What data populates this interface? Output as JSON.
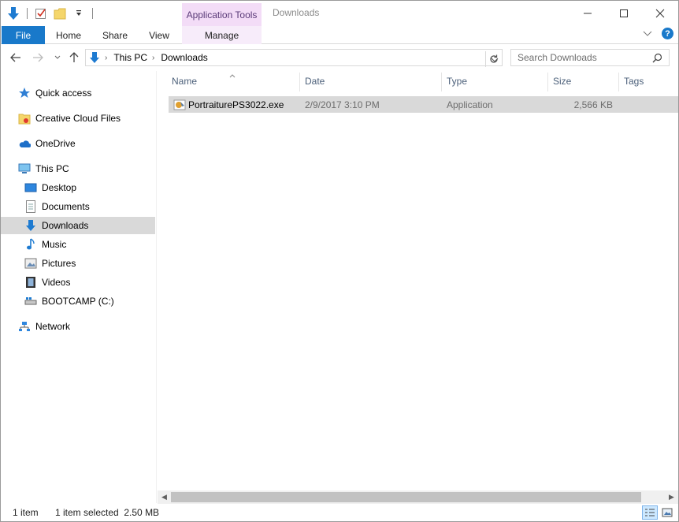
{
  "window": {
    "title": "Downloads",
    "context_tab_header": "Application Tools"
  },
  "ribbon": {
    "tabs": [
      "File",
      "Home",
      "Share",
      "View",
      "Manage"
    ]
  },
  "address": {
    "segments": [
      "This PC",
      "Downloads"
    ]
  },
  "search": {
    "placeholder": "Search Downloads"
  },
  "nav": {
    "items": [
      {
        "label": "Quick access",
        "icon": "star-icon"
      },
      {
        "label": "Creative Cloud Files",
        "icon": "creative-cloud-folder-icon"
      },
      {
        "label": "OneDrive",
        "icon": "cloud-icon"
      },
      {
        "label": "This PC",
        "icon": "computer-icon"
      },
      {
        "label": "Desktop",
        "icon": "desktop-icon"
      },
      {
        "label": "Documents",
        "icon": "document-icon"
      },
      {
        "label": "Downloads",
        "icon": "download-arrow-icon",
        "selected": true
      },
      {
        "label": "Music",
        "icon": "music-note-icon"
      },
      {
        "label": "Pictures",
        "icon": "picture-icon"
      },
      {
        "label": "Videos",
        "icon": "film-icon"
      },
      {
        "label": "BOOTCAMP (C:)",
        "icon": "drive-icon"
      },
      {
        "label": "Network",
        "icon": "network-icon"
      }
    ]
  },
  "list": {
    "columns": [
      "Name",
      "Date",
      "Type",
      "Size",
      "Tags"
    ],
    "rows": [
      {
        "name": "PortraiturePS3022.exe",
        "date": "2/9/2017 3:10 PM",
        "type": "Application",
        "size": "2,566 KB",
        "tags": ""
      }
    ]
  },
  "status": {
    "item_count": "1 item",
    "selection": "1 item selected  2.50 MB"
  },
  "colors": {
    "accent": "#1979ca",
    "context_tab": "#f3dcf7",
    "selection": "#d9d9d9",
    "column_header_text": "#4c607a"
  }
}
